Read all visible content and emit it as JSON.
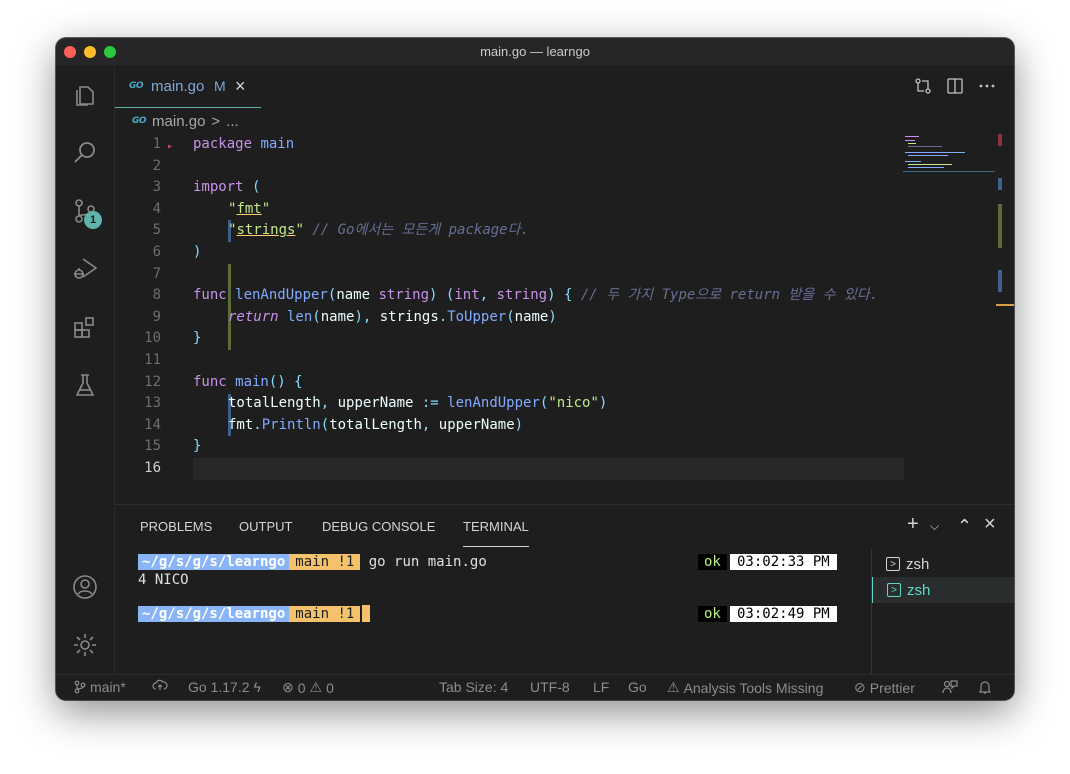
{
  "window": {
    "title": "main.go — learngo"
  },
  "activity": {
    "items": [
      "explorer-icon",
      "search-icon",
      "source-control-icon",
      "run-debug-icon",
      "extensions-icon",
      "testing-icon",
      "account-icon",
      "settings-gear-icon"
    ],
    "scm_badge": "1"
  },
  "tab": {
    "logo": "GO",
    "name": "main.go",
    "modified": "M",
    "close": "×"
  },
  "breadcrumb": {
    "logo": "GO",
    "file": "main.go",
    "separator": ">",
    "more": "..."
  },
  "editor": {
    "line_numbers": [
      "1",
      "2",
      "3",
      "4",
      "5",
      "6",
      "7",
      "8",
      "9",
      "10",
      "11",
      "12",
      "13",
      "14",
      "15",
      "16"
    ],
    "current_line": "16"
  },
  "code": {
    "l1": {
      "kw": "package",
      "name": " main"
    },
    "l3": {
      "kw": "import",
      "paren": " ("
    },
    "l4": {
      "q1": "\"",
      "s": "fmt",
      "q2": "\""
    },
    "l5": {
      "q1": "\"",
      "s": "strings",
      "q2": "\"",
      "cm": " // Go에서는 모든게 package다."
    },
    "l6": {
      "p": ")"
    },
    "l8": {
      "kw": "func",
      "fn": " lenAndUpper",
      "p1": "(",
      "arg": "name",
      "t1": " string",
      "p2": ")",
      "p3": " (",
      "t2": "int",
      "c": ",",
      "t3": " string",
      "p4": ")",
      "p5": " {",
      "cm": " // 두 가지 Type으로 return 받을 수 있다."
    },
    "l9": {
      "kw": "return",
      "fn": " len",
      "p1": "(",
      "a": "name",
      "p2": "),",
      "obj": " strings",
      "dot": ".",
      "fn2": "ToUpper",
      "p3": "(",
      "a2": "name",
      "p4": ")"
    },
    "l10": {
      "p": "}"
    },
    "l12": {
      "kw": "func",
      "fn": " main",
      "p": "()",
      "p2": " {"
    },
    "l13": {
      "a": "totalLength",
      "c": ",",
      "b": " upperName",
      "op": " :=",
      "fn": " lenAndUpper",
      "p1": "(",
      "s": "\"nico\"",
      "p2": ")"
    },
    "l14": {
      "obj": "fmt",
      "dot": ".",
      "fn": "Println",
      "p1": "(",
      "a": "totalLength",
      "c": ",",
      "b": " upperName",
      "p2": ")"
    },
    "l15": {
      "p": "}"
    }
  },
  "panel": {
    "tabs": [
      "PROBLEMS",
      "OUTPUT",
      "DEBUG CONSOLE",
      "TERMINAL"
    ],
    "active_tab": "TERMINAL",
    "add": "+",
    "chevron": "⌵",
    "maximize": "⌃",
    "close": "×"
  },
  "terminal": {
    "prompt1": {
      "path": "~/g/s/g/s/learngo",
      "branch": "main !1",
      "command": " go run main.go",
      "status": "ok",
      "time": "03:02:33 PM"
    },
    "output": "4 NICO",
    "prompt2": {
      "path": "~/g/s/g/s/learngo",
      "branch": "main !1",
      "status": "ok",
      "time": "03:02:49 PM"
    },
    "instances": [
      "zsh",
      "zsh"
    ]
  },
  "statusbar": {
    "branch": "main*",
    "go_version": "Go 1.17.2",
    "errors": "0",
    "warnings": "0",
    "tab_size": "Tab Size: 4",
    "encoding": "UTF-8",
    "eol": "LF",
    "language": "Go",
    "analysis": "Analysis Tools Missing",
    "prettier": "Prettier"
  },
  "colors": {
    "accent": "#5fb3a8",
    "keyword": "#c792ea",
    "function": "#82aaff",
    "string": "#c3e88d",
    "comment": "#676e95",
    "prompt_path": "#8ab4f8",
    "prompt_branch": "#f4c26b"
  }
}
